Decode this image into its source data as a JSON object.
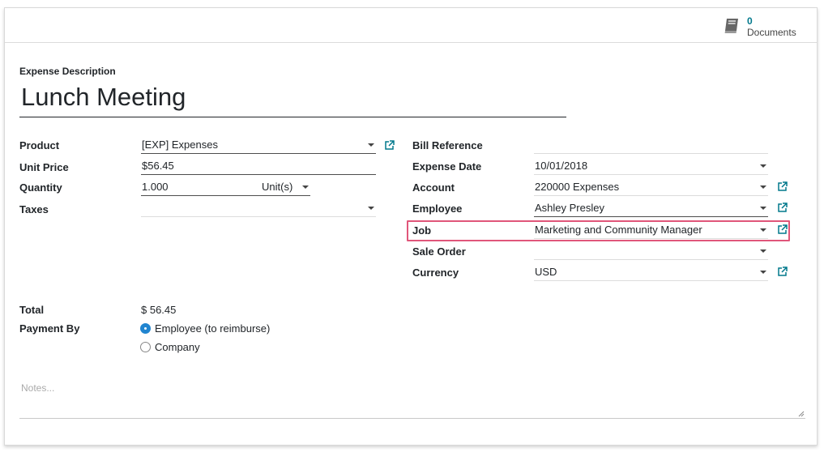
{
  "documents": {
    "count": "0",
    "label": "Documents"
  },
  "title": {
    "label": "Expense Description",
    "value": "Lunch Meeting"
  },
  "left": {
    "product": {
      "label": "Product",
      "value": "[EXP] Expenses"
    },
    "unit_price": {
      "label": "Unit Price",
      "value": "$56.45"
    },
    "quantity": {
      "label": "Quantity",
      "value": "1.000",
      "uom": "Unit(s)"
    },
    "taxes": {
      "label": "Taxes",
      "value": ""
    }
  },
  "right": {
    "bill_reference": {
      "label": "Bill Reference",
      "value": ""
    },
    "expense_date": {
      "label": "Expense Date",
      "value": "10/01/2018"
    },
    "account": {
      "label": "Account",
      "value": "220000 Expenses"
    },
    "employee": {
      "label": "Employee",
      "value": "Ashley Presley"
    },
    "job": {
      "label": "Job",
      "value": "Marketing and Community Manager"
    },
    "sale_order": {
      "label": "Sale Order",
      "value": ""
    },
    "currency": {
      "label": "Currency",
      "value": "USD"
    }
  },
  "total": {
    "label": "Total",
    "value": "$ 56.45"
  },
  "payment": {
    "label": "Payment By",
    "options": [
      {
        "label": "Employee (to reimburse)",
        "selected": true
      },
      {
        "label": "Company",
        "selected": false
      }
    ]
  },
  "notes": {
    "placeholder": "Notes..."
  },
  "colors": {
    "accent": "#00788c",
    "highlight": "#e0567a",
    "radio": "#2185d0"
  }
}
